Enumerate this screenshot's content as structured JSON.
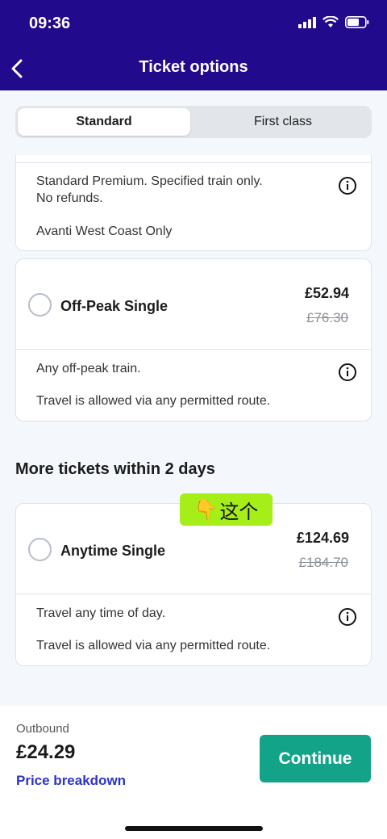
{
  "status_bar": {
    "time": "09:36"
  },
  "header": {
    "title": "Ticket options"
  },
  "tabs": {
    "standard": "Standard",
    "first_class": "First class"
  },
  "premium_card": {
    "desc_line1": "Standard Premium. Specified train only.",
    "desc_line2": "No refunds.",
    "desc_line3": "Avanti West Coast Only"
  },
  "off_peak_card": {
    "name": "Off-Peak Single",
    "price": "£52.94",
    "old_price": "£76.30",
    "desc_line1": "Any off-peak train.",
    "desc_line2": "Travel is allowed via any permitted route."
  },
  "section": {
    "title": "More tickets within 2 days"
  },
  "sticker": {
    "emoji": "👇",
    "text": "这个"
  },
  "anytime_card": {
    "name": "Anytime Single",
    "price": "£124.69",
    "old_price": "£184.70",
    "desc_line1": "Travel any time of day.",
    "desc_line2": "Travel is allowed via any permitted route."
  },
  "bottom": {
    "outbound_label": "Outbound",
    "total": "£24.29",
    "breakdown_link": "Price breakdown",
    "continue_label": "Continue"
  },
  "colors": {
    "header_bg": "#210a8c",
    "accent_green": "#12a389",
    "link_blue": "#2c33c8",
    "sticker_green": "#a6ee18"
  }
}
